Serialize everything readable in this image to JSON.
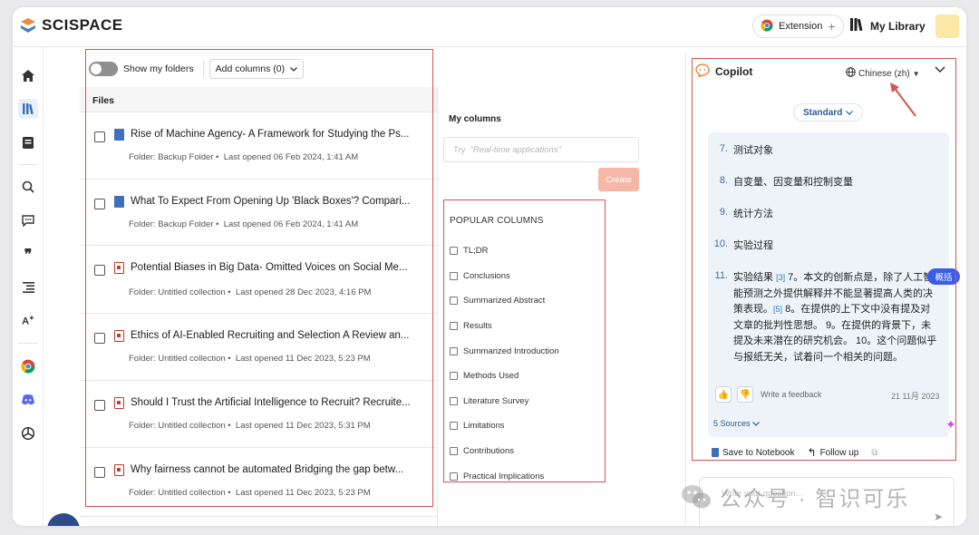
{
  "app": {
    "brand": "SCISPACE",
    "extension_label": "Extension",
    "my_library_label": "My Library"
  },
  "colors": {
    "accent": "#3b5de7",
    "annotation": "#d9534f",
    "create_button": "#f6b8a6",
    "answer_bg": "#eef3f9"
  },
  "rail": {
    "icons": [
      "home-icon",
      "library-icon",
      "notebook-icon",
      "search-paper-icon",
      "chat-icon",
      "quote-icon",
      "outline-icon",
      "paraphrase-icon",
      "chrome-icon",
      "discord-icon",
      "openai-icon"
    ]
  },
  "files": {
    "show_folders_label": "Show my folders",
    "add_columns_label": "Add columns (0)",
    "header": "Files",
    "rows": [
      {
        "title": "Rise of Machine Agency- A Framework for Studying the Ps...",
        "folder": "Folder: Backup Folder •",
        "opened": "Last opened 06 Feb 2024, 1:41 AM",
        "type": "book"
      },
      {
        "title": "What To Expect From Opening Up 'Black Boxes'? Compari...",
        "folder": "Folder: Backup Folder •",
        "opened": "Last opened 06 Feb 2024, 1:41 AM",
        "type": "book"
      },
      {
        "title": "Potential Biases in Big Data- Omitted Voices on Social Me...",
        "folder": "Folder: Untitled collection •",
        "opened": "Last opened 28 Dec 2023, 4:16 PM",
        "type": "pdf"
      },
      {
        "title": "Ethics of AI-Enabled Recruiting and Selection A Review an...",
        "folder": "Folder: Untitled collection •",
        "opened": "Last opened 11 Dec 2023, 5:23 PM",
        "type": "pdf"
      },
      {
        "title": "Should I Trust the Artificial Intelligence to Recruit? Recruite...",
        "folder": "Folder: Untitled collection •",
        "opened": "Last opened 11 Dec 2023, 5:31 PM",
        "type": "pdf"
      },
      {
        "title": "Why fairness cannot be automated Bridging the gap betw...",
        "folder": "Folder: Untitled collection •",
        "opened": "Last opened 11 Dec 2023, 5:23 PM",
        "type": "pdf"
      }
    ]
  },
  "my_columns": {
    "title": "My columns",
    "input_prefix": "Try",
    "input_placeholder": "\"Real-time applications\"",
    "create_label": "Create",
    "popular_title": "POPULAR COLUMNS",
    "popular": [
      "TL;DR",
      "Conclusions",
      "Summarized Abstract",
      "Results",
      "Summarized Introduction",
      "Methods Used",
      "Literature Survey",
      "Limitations",
      "Contributions",
      "Practical Implications"
    ]
  },
  "copilot": {
    "title": "Copilot",
    "language": "Chinese (zh)",
    "mode": "Standard",
    "answer_items": [
      {
        "num": "7.",
        "text": "测试对象"
      },
      {
        "num": "8.",
        "text": "自变量、因变量和控制变量"
      },
      {
        "num": "9.",
        "text": "统计方法"
      },
      {
        "num": "10.",
        "text": "实验过程"
      }
    ],
    "item11_num": "11.",
    "item11_a": "实验结果 ",
    "item11_cite1": "[3]",
    "item11_b": " 7。本文的创新点是，除了人工智能预测之外提供解释并不能显著提高人类的决策表现。",
    "item11_cite2": "[5]",
    "item11_c": " 8。在提供的上下文中没有提及对文章的批判性思想。 9。在提供的背景下，未提及未来潜在的研究机会。 10。这个问题似乎与报纸无关，试着问一个相关的问题。",
    "feedback_label": "Write a feedback",
    "date": "21 11月 2023",
    "sources_label": "5 Sources",
    "summary_badge": "概括",
    "save_label": "Save to Notebook",
    "follow_label": "Follow up",
    "ask_placeholder": "Write your question..."
  },
  "watermark": {
    "text": "公众号 · 智识可乐"
  }
}
